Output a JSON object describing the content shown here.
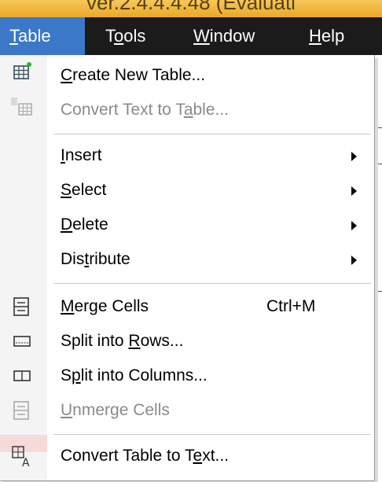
{
  "window": {
    "title_fragment": "ver.2.4.4.4.48 (Evaluati"
  },
  "menubar": {
    "items": [
      {
        "label": "Table",
        "underline_index": 0,
        "active": true
      },
      {
        "label": "Tools",
        "underline_index": 1
      },
      {
        "label": "Window",
        "underline_index": 0
      },
      {
        "label": "Help",
        "underline_index": 0
      }
    ]
  },
  "table_menu": {
    "items": [
      {
        "id": "create",
        "label": "Create New Table...",
        "mnemonic_index": 0,
        "icon": "table-add-icon"
      },
      {
        "id": "convert_text",
        "label": "Convert Text to Table...",
        "mnemonic_index": 17,
        "disabled": true,
        "icon": "text-to-table-icon"
      },
      {
        "id": "insert",
        "label": "Insert",
        "mnemonic_index": 0,
        "submenu": true
      },
      {
        "id": "select",
        "label": "Select",
        "mnemonic_index": 0,
        "submenu": true
      },
      {
        "id": "delete",
        "label": "Delete",
        "mnemonic_index": 0,
        "submenu": true
      },
      {
        "id": "distribute",
        "label": "Distribute",
        "mnemonic_index": 3,
        "submenu": true
      },
      {
        "id": "merge",
        "label": "Merge Cells",
        "mnemonic_index": 0,
        "shortcut": "Ctrl+M",
        "icon": "merge-cells-icon"
      },
      {
        "id": "split_rows",
        "label": "Split into Rows...",
        "mnemonic_index": 11,
        "icon": "split-rows-icon"
      },
      {
        "id": "split_cols",
        "label": "Split into Columns...",
        "mnemonic_index": 1,
        "icon": "split-columns-icon"
      },
      {
        "id": "unmerge",
        "label": "Unmerge Cells",
        "mnemonic_index": 0,
        "disabled": true,
        "icon": "unmerge-cells-icon"
      },
      {
        "id": "convert_table",
        "label": "Convert Table to Text...",
        "mnemonic_index": 18,
        "icon": "table-to-text-icon"
      }
    ]
  },
  "colors": {
    "menubar_bg": "#1b1b1b",
    "active_menu": "#3b78c8",
    "disabled_text": "#8a8a8a"
  }
}
